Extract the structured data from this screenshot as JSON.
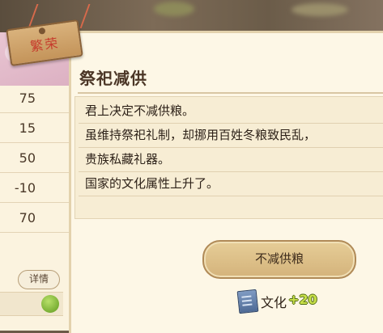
{
  "tag": {
    "label": "繁荣"
  },
  "stats": [
    {
      "value": "75"
    },
    {
      "value": "15"
    },
    {
      "value": "50"
    },
    {
      "value": "-10"
    },
    {
      "value": "70"
    }
  ],
  "detail_button": {
    "label": "详情"
  },
  "event": {
    "title": "祭祀减供",
    "lines": [
      "君上决定不减供粮。",
      "虽维持祭祀礼制，却挪用百姓冬粮致民乱，",
      "贵族私藏礼器。",
      "国家的文化属性上升了。"
    ],
    "choice_label": "不减供粮",
    "reward": {
      "label": "文化",
      "value": "+20",
      "icon": "book-icon"
    }
  },
  "colors": {
    "reward_value": "#c8e04a",
    "tag_text": "#c63b2c",
    "check": "#5f9a1e"
  }
}
